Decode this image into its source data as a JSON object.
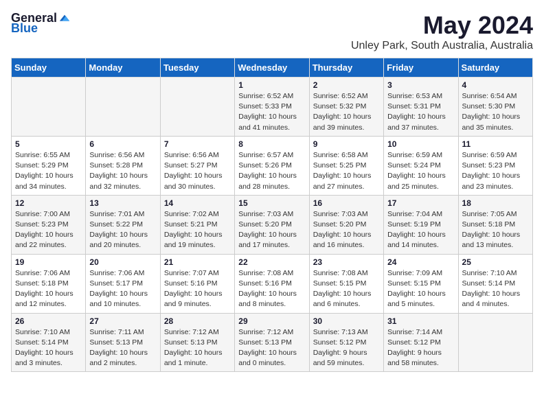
{
  "header": {
    "logo": {
      "general": "General",
      "blue": "Blue"
    },
    "month": "May 2024",
    "location": "Unley Park, South Australia, Australia"
  },
  "weekdays": [
    "Sunday",
    "Monday",
    "Tuesday",
    "Wednesday",
    "Thursday",
    "Friday",
    "Saturday"
  ],
  "weeks": [
    [
      {
        "day": "",
        "info": ""
      },
      {
        "day": "",
        "info": ""
      },
      {
        "day": "",
        "info": ""
      },
      {
        "day": "1",
        "info": "Sunrise: 6:52 AM\nSunset: 5:33 PM\nDaylight: 10 hours\nand 41 minutes."
      },
      {
        "day": "2",
        "info": "Sunrise: 6:52 AM\nSunset: 5:32 PM\nDaylight: 10 hours\nand 39 minutes."
      },
      {
        "day": "3",
        "info": "Sunrise: 6:53 AM\nSunset: 5:31 PM\nDaylight: 10 hours\nand 37 minutes."
      },
      {
        "day": "4",
        "info": "Sunrise: 6:54 AM\nSunset: 5:30 PM\nDaylight: 10 hours\nand 35 minutes."
      }
    ],
    [
      {
        "day": "5",
        "info": "Sunrise: 6:55 AM\nSunset: 5:29 PM\nDaylight: 10 hours\nand 34 minutes."
      },
      {
        "day": "6",
        "info": "Sunrise: 6:56 AM\nSunset: 5:28 PM\nDaylight: 10 hours\nand 32 minutes."
      },
      {
        "day": "7",
        "info": "Sunrise: 6:56 AM\nSunset: 5:27 PM\nDaylight: 10 hours\nand 30 minutes."
      },
      {
        "day": "8",
        "info": "Sunrise: 6:57 AM\nSunset: 5:26 PM\nDaylight: 10 hours\nand 28 minutes."
      },
      {
        "day": "9",
        "info": "Sunrise: 6:58 AM\nSunset: 5:25 PM\nDaylight: 10 hours\nand 27 minutes."
      },
      {
        "day": "10",
        "info": "Sunrise: 6:59 AM\nSunset: 5:24 PM\nDaylight: 10 hours\nand 25 minutes."
      },
      {
        "day": "11",
        "info": "Sunrise: 6:59 AM\nSunset: 5:23 PM\nDaylight: 10 hours\nand 23 minutes."
      }
    ],
    [
      {
        "day": "12",
        "info": "Sunrise: 7:00 AM\nSunset: 5:23 PM\nDaylight: 10 hours\nand 22 minutes."
      },
      {
        "day": "13",
        "info": "Sunrise: 7:01 AM\nSunset: 5:22 PM\nDaylight: 10 hours\nand 20 minutes."
      },
      {
        "day": "14",
        "info": "Sunrise: 7:02 AM\nSunset: 5:21 PM\nDaylight: 10 hours\nand 19 minutes."
      },
      {
        "day": "15",
        "info": "Sunrise: 7:03 AM\nSunset: 5:20 PM\nDaylight: 10 hours\nand 17 minutes."
      },
      {
        "day": "16",
        "info": "Sunrise: 7:03 AM\nSunset: 5:20 PM\nDaylight: 10 hours\nand 16 minutes."
      },
      {
        "day": "17",
        "info": "Sunrise: 7:04 AM\nSunset: 5:19 PM\nDaylight: 10 hours\nand 14 minutes."
      },
      {
        "day": "18",
        "info": "Sunrise: 7:05 AM\nSunset: 5:18 PM\nDaylight: 10 hours\nand 13 minutes."
      }
    ],
    [
      {
        "day": "19",
        "info": "Sunrise: 7:06 AM\nSunset: 5:18 PM\nDaylight: 10 hours\nand 12 minutes."
      },
      {
        "day": "20",
        "info": "Sunrise: 7:06 AM\nSunset: 5:17 PM\nDaylight: 10 hours\nand 10 minutes."
      },
      {
        "day": "21",
        "info": "Sunrise: 7:07 AM\nSunset: 5:16 PM\nDaylight: 10 hours\nand 9 minutes."
      },
      {
        "day": "22",
        "info": "Sunrise: 7:08 AM\nSunset: 5:16 PM\nDaylight: 10 hours\nand 8 minutes."
      },
      {
        "day": "23",
        "info": "Sunrise: 7:08 AM\nSunset: 5:15 PM\nDaylight: 10 hours\nand 6 minutes."
      },
      {
        "day": "24",
        "info": "Sunrise: 7:09 AM\nSunset: 5:15 PM\nDaylight: 10 hours\nand 5 minutes."
      },
      {
        "day": "25",
        "info": "Sunrise: 7:10 AM\nSunset: 5:14 PM\nDaylight: 10 hours\nand 4 minutes."
      }
    ],
    [
      {
        "day": "26",
        "info": "Sunrise: 7:10 AM\nSunset: 5:14 PM\nDaylight: 10 hours\nand 3 minutes."
      },
      {
        "day": "27",
        "info": "Sunrise: 7:11 AM\nSunset: 5:13 PM\nDaylight: 10 hours\nand 2 minutes."
      },
      {
        "day": "28",
        "info": "Sunrise: 7:12 AM\nSunset: 5:13 PM\nDaylight: 10 hours\nand 1 minute."
      },
      {
        "day": "29",
        "info": "Sunrise: 7:12 AM\nSunset: 5:13 PM\nDaylight: 10 hours\nand 0 minutes."
      },
      {
        "day": "30",
        "info": "Sunrise: 7:13 AM\nSunset: 5:12 PM\nDaylight: 9 hours\nand 59 minutes."
      },
      {
        "day": "31",
        "info": "Sunrise: 7:14 AM\nSunset: 5:12 PM\nDaylight: 9 hours\nand 58 minutes."
      },
      {
        "day": "",
        "info": ""
      }
    ]
  ]
}
